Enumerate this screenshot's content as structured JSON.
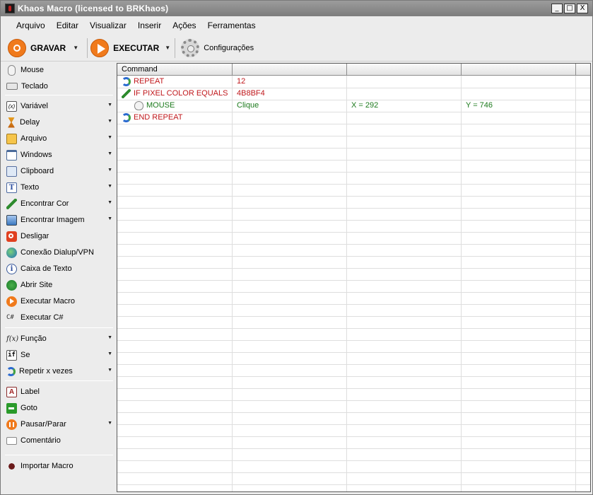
{
  "window": {
    "title": "Khaos Macro (licensed to BRKhaos)",
    "controls": [
      "_",
      "□",
      "X"
    ]
  },
  "menu": [
    "Arquivo",
    "Editar",
    "Visualizar",
    "Inserir",
    "Ações",
    "Ferramentas"
  ],
  "toolbar": {
    "record_label": "GRAVAR",
    "run_label": "EXECUTAR",
    "config_label": "Configurações"
  },
  "sidebar": {
    "groups": [
      [
        {
          "label": "Mouse",
          "icon": "mouse-icon",
          "dropdown": false
        },
        {
          "label": "Teclado",
          "icon": "keyboard-icon",
          "dropdown": false
        }
      ],
      [
        {
          "label": "Variável",
          "icon": "variable-icon",
          "dropdown": true
        },
        {
          "label": "Delay",
          "icon": "hourglass-icon",
          "dropdown": true
        },
        {
          "label": "Arquivo",
          "icon": "file-icon",
          "dropdown": true
        },
        {
          "label": "Windows",
          "icon": "window-icon",
          "dropdown": true
        },
        {
          "label": "Clipboard",
          "icon": "clipboard-icon",
          "dropdown": true
        },
        {
          "label": "Texto",
          "icon": "text-icon",
          "dropdown": true
        },
        {
          "label": "Encontrar Cor",
          "icon": "eyedropper-icon",
          "dropdown": true
        },
        {
          "label": "Encontrar Imagem",
          "icon": "image-icon",
          "dropdown": true
        },
        {
          "label": "Desligar",
          "icon": "power-icon",
          "dropdown": false
        },
        {
          "label": "Conexão Dialup/VPN",
          "icon": "globe-icon",
          "dropdown": false
        },
        {
          "label": "Caixa de Texto",
          "icon": "info-icon",
          "dropdown": false
        },
        {
          "label": "Abrir Site",
          "icon": "browser-icon",
          "dropdown": false
        },
        {
          "label": "Executar Macro",
          "icon": "play-icon",
          "dropdown": false
        },
        {
          "label": "Executar C#",
          "icon": "csharp-icon",
          "dropdown": false
        }
      ],
      [
        {
          "label": "Função",
          "icon": "function-icon",
          "dropdown": true
        },
        {
          "label": "Se",
          "icon": "if-icon",
          "dropdown": true
        },
        {
          "label": "Repetir x vezes",
          "icon": "repeat-icon",
          "dropdown": true
        }
      ],
      [
        {
          "label": "Label",
          "icon": "label-icon",
          "dropdown": false
        },
        {
          "label": "Goto",
          "icon": "goto-arrow-icon",
          "dropdown": false
        },
        {
          "label": "Pausar/Parar",
          "icon": "pause-icon",
          "dropdown": true
        },
        {
          "label": "Comentário",
          "icon": "comment-icon",
          "dropdown": false
        }
      ],
      [
        {
          "label": "Importar Macro",
          "icon": "bug-icon",
          "dropdown": false
        }
      ]
    ]
  },
  "grid": {
    "columns": [
      "Command",
      "",
      "",
      ""
    ],
    "rows": [
      {
        "command": "REPEAT",
        "icon": "repeat-icon",
        "indent": 0,
        "color": "red",
        "c2": "12",
        "c3": "",
        "c4": ""
      },
      {
        "command": "IF PIXEL COLOR EQUALS",
        "icon": "eyedropper-icon",
        "indent": 0,
        "color": "red",
        "c2": "4B8BF4",
        "c3": "",
        "c4": ""
      },
      {
        "command": "MOUSE",
        "icon": "mouse-icon",
        "indent": 1,
        "color": "green",
        "c2": "Clique",
        "c3": "X = 292",
        "c4": "Y = 746"
      },
      {
        "command": "END REPEAT",
        "icon": "repeat-icon",
        "indent": 0,
        "color": "red",
        "c2": "",
        "c3": "",
        "c4": ""
      }
    ]
  }
}
